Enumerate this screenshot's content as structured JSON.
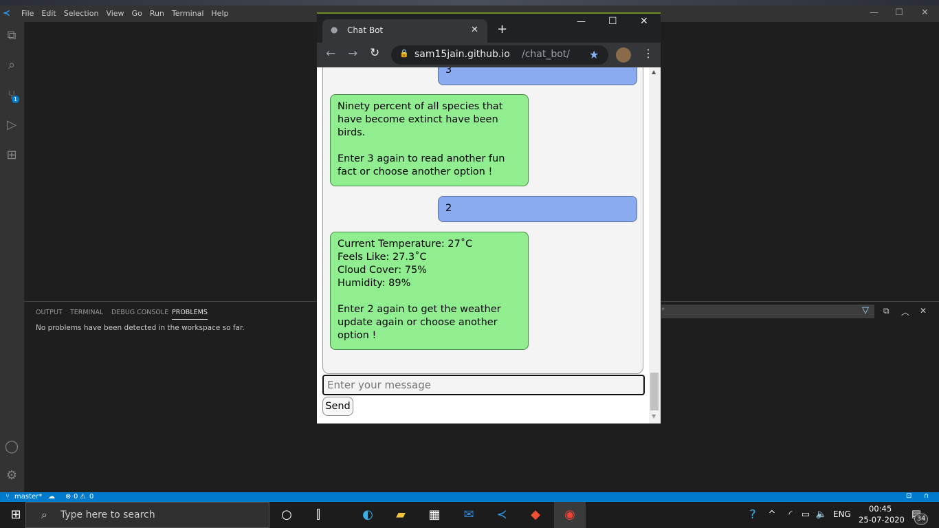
{
  "vscode": {
    "menu": [
      "File",
      "Edit",
      "Selection",
      "View",
      "Go",
      "Run",
      "Terminal",
      "Help"
    ],
    "scm_badge": "1",
    "panel": {
      "tabs": [
        "OUTPUT",
        "TERMINAL",
        "DEBUG CONSOLE",
        "PROBLEMS"
      ],
      "active_tab": "PROBLEMS",
      "message": "No problems have been detected in the workspace so far.",
      "filter_value": "*"
    },
    "status": {
      "branch": "master*",
      "errors": "0",
      "warnings": "0"
    }
  },
  "browser": {
    "tab_title": "Chat Bot",
    "url_host": "sam15jain.github.io",
    "url_path": "/chat_bot/",
    "colors": {
      "user_bubble": "#8aabf0",
      "bot_bubble": "#90ee90"
    },
    "messages": [
      {
        "from": "user",
        "text": "3"
      },
      {
        "from": "bot",
        "text": "Ninety percent of all species that have become extinct have been birds.\n\nEnter 3 again to read another fun fact or choose another option !"
      },
      {
        "from": "user",
        "text": "2"
      },
      {
        "from": "bot",
        "text": "Current Temperature: 27˚C\nFeels Like: 27.3˚C\nCloud Cover: 75%\nHumidity: 89%\n\nEnter 2 again to get the weather update again or choose another option !"
      }
    ],
    "input_placeholder": "Enter your message",
    "send_label": "Send"
  },
  "taskbar": {
    "search_placeholder": "Type here to search",
    "lang": "ENG",
    "time": "00:45",
    "date": "25-07-2020",
    "notifications": "34"
  }
}
